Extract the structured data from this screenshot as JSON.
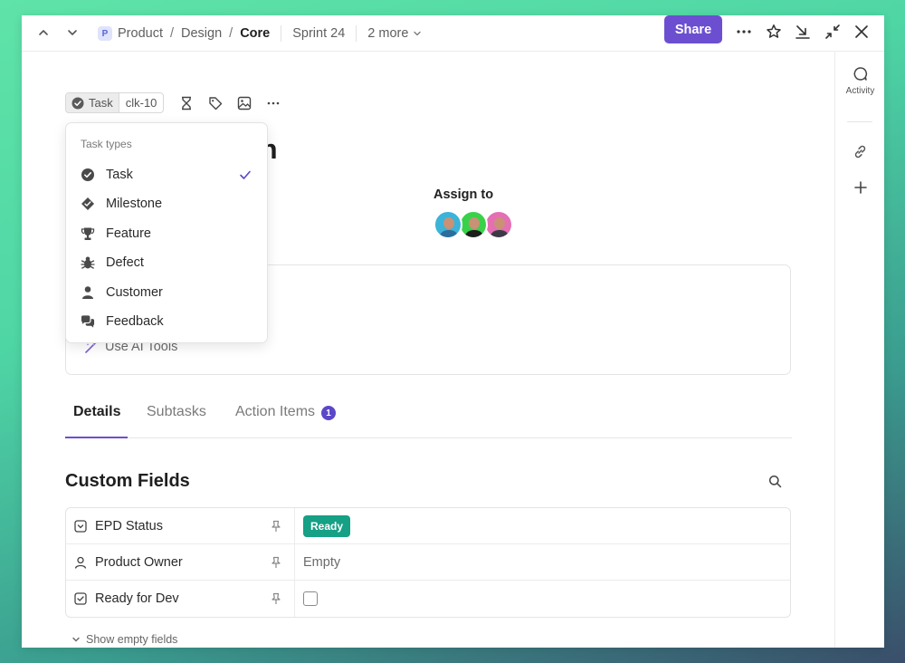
{
  "breadcrumb": {
    "space_letter": "P",
    "items": [
      "Product",
      "Design",
      "Core"
    ],
    "sprint": "Sprint 24",
    "more": "2 more"
  },
  "topbar": {
    "share_label": "Share"
  },
  "sidebar": {
    "activity_label": "Activity"
  },
  "task": {
    "type_label": "Task",
    "id": "clk-10",
    "title_visible": "gn",
    "assign_label": "Assign to",
    "assignees": [
      {
        "bg": "#3cb3d8",
        "shirt": "#2d6d9c"
      },
      {
        "bg": "#3ad14a",
        "shirt": "#1d1d1d"
      },
      {
        "bg": "#e56fb3",
        "shirt": "#3b3b47"
      }
    ]
  },
  "description": {
    "ai_tools_label": "Use AI Tools"
  },
  "task_type_menu": {
    "heading": "Task types",
    "items": [
      {
        "label": "Task",
        "icon": "check-circle-icon",
        "selected": true
      },
      {
        "label": "Milestone",
        "icon": "diamond-icon",
        "selected": false
      },
      {
        "label": "Feature",
        "icon": "trophy-icon",
        "selected": false
      },
      {
        "label": "Defect",
        "icon": "bug-icon",
        "selected": false
      },
      {
        "label": "Customer",
        "icon": "person-icon",
        "selected": false
      },
      {
        "label": "Feedback",
        "icon": "chat-bubbles-icon",
        "selected": false
      }
    ]
  },
  "tabs": [
    {
      "label": "Details",
      "active": true
    },
    {
      "label": "Subtasks",
      "active": false
    },
    {
      "label": "Action Items",
      "active": false,
      "badge": "1"
    }
  ],
  "custom_fields": {
    "title": "Custom Fields",
    "rows": [
      {
        "name": "EPD Status",
        "icon": "dropdown-field-icon",
        "value": "Ready",
        "value_color": "#16a085"
      },
      {
        "name": "Product Owner",
        "icon": "person-field-icon",
        "value": "Empty"
      },
      {
        "name": "Ready for Dev",
        "icon": "checkbox-field-icon",
        "value": "",
        "checked": false
      }
    ],
    "show_empty_label": "Show empty fields"
  },
  "colors": {
    "accent": "#6c4fd0",
    "status_ready": "#16a085"
  }
}
